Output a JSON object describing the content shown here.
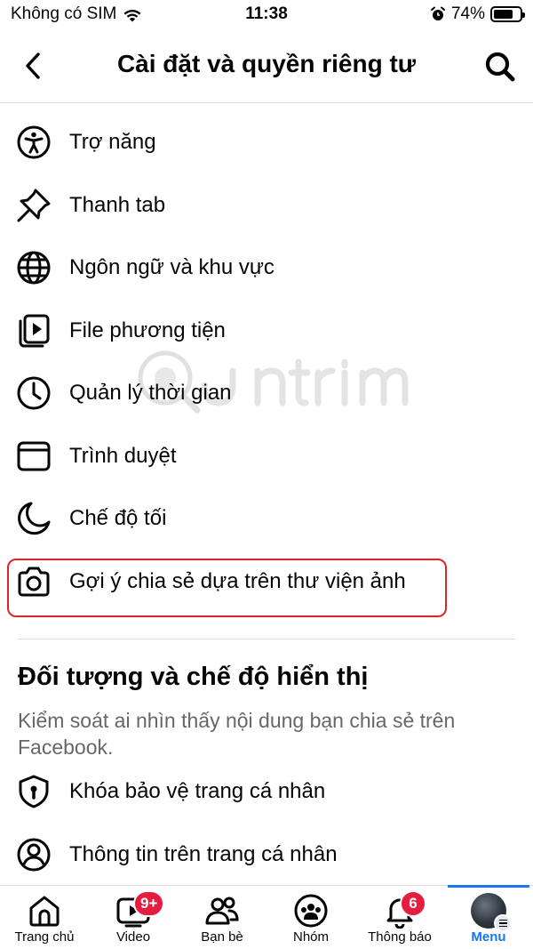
{
  "status_bar": {
    "carrier": "Không có SIM",
    "time": "11:38",
    "battery": "74%",
    "battery_level": 0.74
  },
  "header": {
    "title": "Cài đặt và quyền riêng tư"
  },
  "menu_items": [
    {
      "label": "Trợ năng",
      "icon": "accessibility-icon"
    },
    {
      "label": "Thanh tab",
      "icon": "pin-icon"
    },
    {
      "label": "Ngôn ngữ và khu vực",
      "icon": "globe-icon"
    },
    {
      "label": "File phương tiện",
      "icon": "media-file-icon"
    },
    {
      "label": "Quản lý thời gian",
      "icon": "clock-icon"
    },
    {
      "label": "Trình duyệt",
      "icon": "browser-icon"
    },
    {
      "label": "Chế độ tối",
      "icon": "moon-icon"
    },
    {
      "label": "Gợi ý chia sẻ dựa trên thư viện ảnh",
      "icon": "camera-icon"
    }
  ],
  "section": {
    "title": "Đối tượng và chế độ hiển thị",
    "description": "Kiểm soát ai nhìn thấy nội dung bạn chia sẻ trên Facebook."
  },
  "section_items": [
    {
      "label": "Khóa bảo vệ trang cá nhân",
      "icon": "shield-lock-icon"
    },
    {
      "label": "Thông tin trên trang cá nhân",
      "icon": "profile-circle-icon"
    }
  ],
  "tabs": [
    {
      "label": "Trang chủ",
      "icon": "home-icon",
      "badge": ""
    },
    {
      "label": "Video",
      "icon": "video-icon",
      "badge": "9+"
    },
    {
      "label": "Bạn bè",
      "icon": "friends-icon",
      "badge": ""
    },
    {
      "label": "Nhóm",
      "icon": "groups-icon",
      "badge": ""
    },
    {
      "label": "Thông báo",
      "icon": "bell-icon",
      "badge": "6"
    },
    {
      "label": "Menu",
      "icon": "menu-avatar-icon",
      "badge": ""
    }
  ],
  "colors": {
    "accent": "#1877f2",
    "highlight_border": "#e0242f",
    "badge": "#e41e3f"
  }
}
